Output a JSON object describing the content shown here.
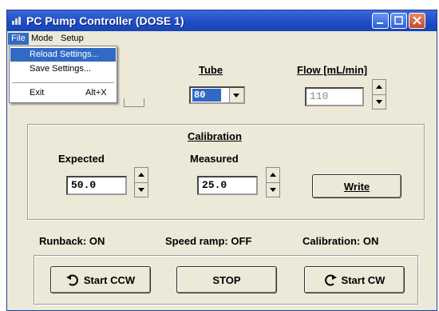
{
  "window": {
    "title": "PC Pump Controller (DOSE 1)"
  },
  "menubar": {
    "items": [
      {
        "label": "File"
      },
      {
        "label": "Mode"
      },
      {
        "label": "Setup"
      }
    ]
  },
  "file_menu": {
    "items": [
      {
        "label": "Reload Settings...",
        "shortcut": ""
      },
      {
        "label": "Save Settings...",
        "shortcut": ""
      },
      {
        "label": "Exit",
        "shortcut": "Alt+X"
      }
    ]
  },
  "tube": {
    "label": "Tube",
    "value": "80"
  },
  "flow": {
    "label": "Flow [mL/min]",
    "value": "110"
  },
  "calibration": {
    "title": "Calibration",
    "expected_label": "Expected",
    "expected_value": "50.0",
    "measured_label": "Measured",
    "measured_value": "25.0",
    "write_label": "Write"
  },
  "status": {
    "runback": "Runback: ON",
    "speed_ramp": "Speed ramp: OFF",
    "calibration": "Calibration: ON"
  },
  "controls": {
    "start_ccw": "Start CCW",
    "stop": "STOP",
    "start_cw": "Start CW"
  },
  "icons": {
    "app": "pump-icon",
    "ccw": "rotate-ccw-icon",
    "cw": "rotate-cw-icon"
  },
  "colors": {
    "titlebar": "#1c4cc5",
    "selection": "#316ac5",
    "face": "#ece9d8"
  }
}
